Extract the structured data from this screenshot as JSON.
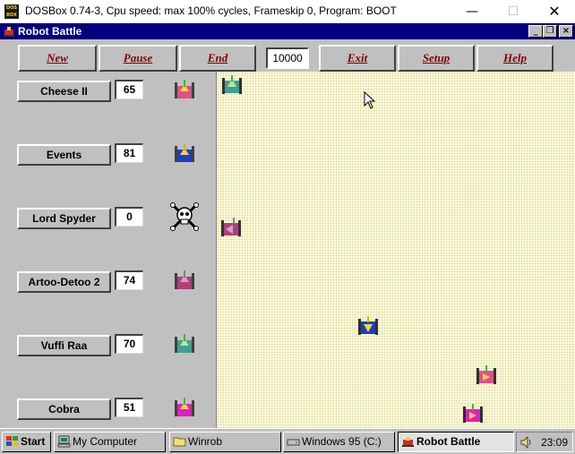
{
  "host_window": {
    "title": "DOSBox 0.74-3, Cpu speed: max 100% cycles, Frameskip  0, Program:     BOOT",
    "logo_text": "DOS BOX",
    "minimize_symbol": "—",
    "maximize_symbol": "☐",
    "close_symbol": "✕"
  },
  "app_window": {
    "title": "Robot Battle",
    "minimize_symbol": "_",
    "restore_symbol": "❐",
    "close_symbol": "×"
  },
  "toolbar": {
    "new_label": "New",
    "pause_label": "Pause",
    "end_label": "End",
    "score_limit": "10000",
    "exit_label": "Exit",
    "setup_label": "Setup",
    "help_label": "Help"
  },
  "robots": [
    {
      "name": "Cheese II",
      "score": "65",
      "icon": "tank-icon",
      "status": "alive",
      "color": "#e0508a"
    },
    {
      "name": "Events",
      "score": "81",
      "icon": "tank-icon",
      "status": "alive",
      "color": "#1a3fc0"
    },
    {
      "name": "Lord Spyder",
      "score": "0",
      "icon": "skull-crossbones-icon",
      "status": "dead",
      "color": "#000000"
    },
    {
      "name": "Artoo-Detoo 2",
      "score": "74",
      "icon": "tank-icon",
      "status": "alive",
      "color": "#b0407a"
    },
    {
      "name": "Vuffi Raa",
      "score": "70",
      "icon": "tank-icon",
      "status": "alive",
      "color": "#40a090"
    },
    {
      "name": "Cobra",
      "score": "51",
      "icon": "tank-icon",
      "status": "alive",
      "color": "#e020c0"
    }
  ],
  "taskbar": {
    "start_label": "Start",
    "items": [
      {
        "label": "My Computer",
        "icon": "computer-icon"
      },
      {
        "label": "Winrob",
        "icon": "folder-icon"
      },
      {
        "label": "Windows 95 (C:)",
        "icon": "drive-icon"
      },
      {
        "label": "Robot Battle",
        "icon": "robot-battle-icon",
        "active": true
      }
    ],
    "clock": "23:09",
    "tray_icon": "speaker-icon"
  },
  "colors": {
    "titlebar": "#000080",
    "desktop": "#008080",
    "arena_bg": "#fffbe0",
    "toolbar_text": "#800000"
  }
}
